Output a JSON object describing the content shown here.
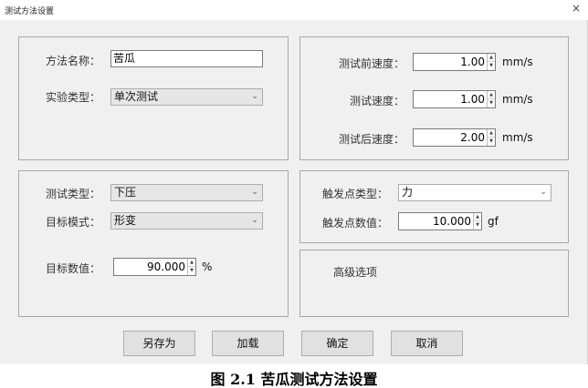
{
  "window": {
    "title": "测试方法设置",
    "close_glyph": "×"
  },
  "method_panel": {
    "name_label": "方法名称：",
    "name_value": "苦瓜",
    "experiment_type_label": "实验类型：",
    "experiment_type_value": "单次测试"
  },
  "speed_panel": {
    "pre_speed_label": "测试前速度：",
    "pre_speed_value": "1.00",
    "test_speed_label": "测试速度：",
    "test_speed_value": "1.00",
    "post_speed_label": "测试后速度：",
    "post_speed_value": "2.00",
    "unit": "mm/s"
  },
  "test_panel": {
    "test_type_label": "测试类型：",
    "test_type_value": "下压",
    "target_mode_label": "目标模式：",
    "target_mode_value": "形变",
    "target_value_label": "目标数值：",
    "target_value": "90.000",
    "target_unit": "%"
  },
  "trigger_panel": {
    "trigger_type_label": "触发点类型：",
    "trigger_type_value": "力",
    "trigger_value_label": "触发点数值：",
    "trigger_value": "10.000",
    "trigger_unit": "gf"
  },
  "advanced_panel": {
    "label": "高级选项"
  },
  "buttons": {
    "save_as": "另存为",
    "load": "加载",
    "ok": "确定",
    "cancel": "取消"
  },
  "icons": {
    "dropdown": "chevron-down-icon",
    "spin_up": "spin-up-icon",
    "spin_down": "spin-down-icon",
    "close": "close-icon"
  },
  "caption": "图 2.1 苦瓜测试方法设置"
}
